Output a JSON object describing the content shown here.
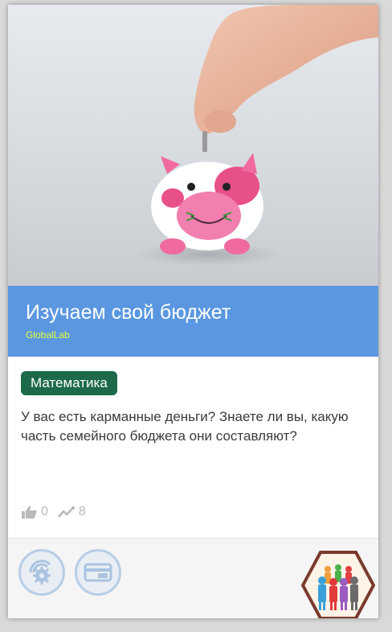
{
  "card": {
    "title": "Изучаем свой бюджет",
    "author": "GlobalLab",
    "subject_tag": "Математика",
    "description": "У вас есть карманные деньги? Знаете ли вы, какую часть семейного бюджета они составляют?",
    "image_alt": "hand putting coin into piggy bank",
    "stats": {
      "likes": "0",
      "views": "8",
      "like_icon": "thumbs-up-icon",
      "views_icon": "trend-line-icon"
    }
  },
  "footer": {
    "buttons": [
      {
        "icon": "gear-wave-icon"
      },
      {
        "icon": "card-icon"
      }
    ],
    "badge_icon": "people-group-icon"
  },
  "colors": {
    "title_band": "#5a97e0",
    "author": "#e8ff3a",
    "subject_tag": "#1d6a4b",
    "badge_border": "#7a3a2c"
  }
}
